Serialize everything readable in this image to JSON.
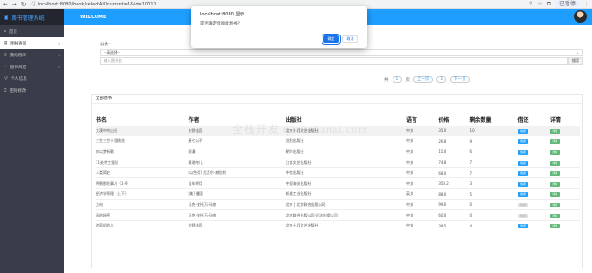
{
  "browser": {
    "url": "localhost:8080/book/selectAll?current=1&id=10011",
    "account_label": "已暂停"
  },
  "sidebar": {
    "brand": "图书管理系统",
    "items": [
      {
        "label": "首页",
        "icon": "home-icon",
        "arrow": ""
      },
      {
        "label": "图书查询",
        "icon": "book-icon",
        "arrow": "›"
      },
      {
        "label": "我的借阅",
        "icon": "list-icon",
        "arrow": "›"
      },
      {
        "label": "图书归还",
        "icon": "return-icon",
        "arrow": "›"
      },
      {
        "label": "个人信息",
        "icon": "user-icon",
        "arrow": ""
      },
      {
        "label": "密码修改",
        "icon": "lock-icon",
        "arrow": ""
      }
    ]
  },
  "header": {
    "title": "WELCOME"
  },
  "filter": {
    "category_label": "分类：",
    "category_value": "--请选择--",
    "search_placeholder": "输入图书名",
    "search_button": "搜索"
  },
  "pager": {
    "first": "首页",
    "prev": "上一页",
    "page": "1",
    "next": "下一页",
    "total_label": "页",
    "prefix": "共"
  },
  "card": {
    "title": "全部图书"
  },
  "table": {
    "headers": [
      "书名",
      "作者",
      "出版社",
      "语言",
      "价格",
      "剩余数量",
      "借还",
      "详情"
    ],
    "rows": [
      [
        "大漠中的山谷",
        "东野圭吾",
        "北京十月文艺出版社",
        "中文",
        "35.0",
        "10"
      ],
      [
        "三生三世十里桃花",
        "唐七公子",
        "沈阳出版社",
        "中文",
        "26.8",
        "9"
      ],
      [
        "你以梦新歌",
        "顾漫",
        "朝华出版社",
        "中文",
        "15.0",
        "6"
      ],
      [
        "11处特工皇妃",
        "潇湘冬儿",
        "江苏文艺出版社",
        "中文",
        "74.8",
        "7"
      ],
      [
        "人类简史",
        "[以色列] 尤瓦尔·赫拉利",
        "中信出版社",
        "中文",
        "68.0",
        "7"
      ],
      [
        "明朝那些事儿（1-9）",
        "当年明月",
        "中国海关出版社",
        "中文",
        "358.2",
        "3"
      ],
      [
        "经济学原理（上下）",
        "[美] 曼昆",
        "机械工业出版社",
        "英文",
        "88.0",
        "5"
      ],
      [
        "方向",
        "马克-安托万·马修",
        "北京 | 北京联合出版公司",
        "中文",
        "99.0",
        "0"
      ],
      [
        "画的秘密",
        "马克-安托万·马修",
        "北京联合出版公司·后浪出版公司",
        "中文",
        "60.0",
        "0"
      ],
      [
        "造窑机的人",
        "东野圭吾",
        "北京十月文艺出版社",
        "中文",
        "39.5",
        "4"
      ]
    ],
    "borrow_label": "借阅",
    "detail_label": "详情"
  },
  "watermark": "全栈开发 quanzhanai.com",
  "dialog": {
    "title": "localhost:8080 显示",
    "message": "是否确定借阅此图书？",
    "ok": "确定",
    "cancel": "取消"
  }
}
